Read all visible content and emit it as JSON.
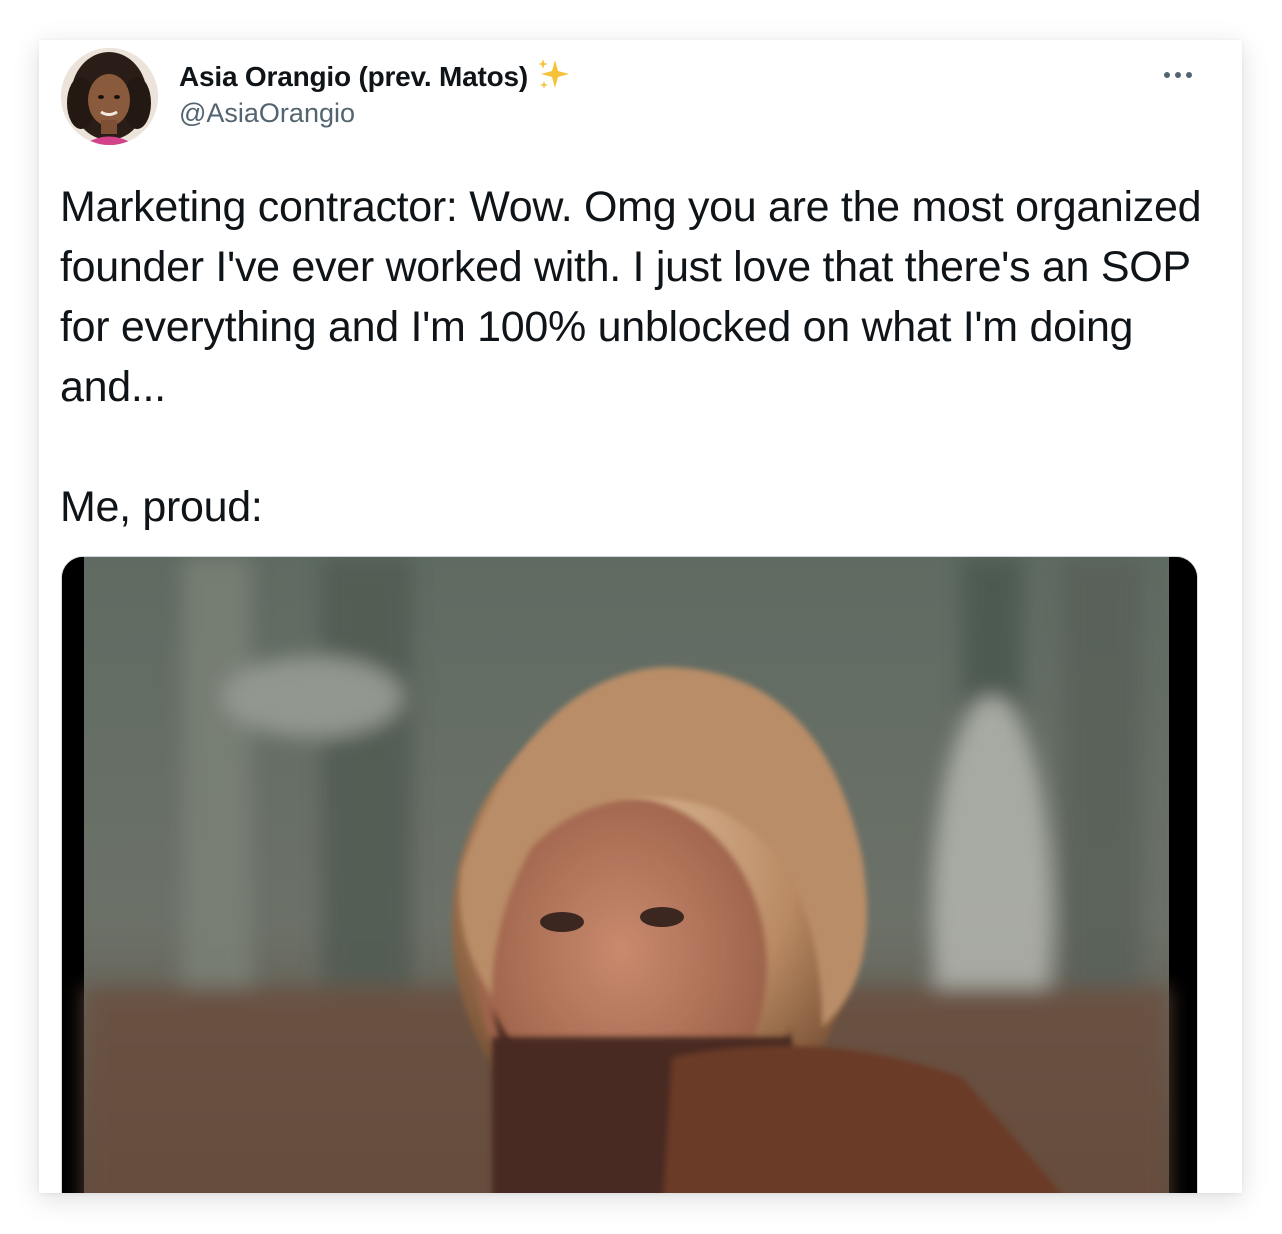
{
  "tweet": {
    "author": {
      "display_name": "Asia Orangio (prev. Matos)",
      "handle": "@AsiaOrangio",
      "badge_icon": "sparkles-icon",
      "avatar_icon": "profile-photo"
    },
    "more_icon": "more-horizontal-icon",
    "text": "Marketing contractor: Wow. Omg you are the most organized founder I've ever worked with. I just love that there's an SOP for everything and I'm 100% unblocked on what I'm doing and...\n\nMe, proud:",
    "media": {
      "kind": "video-still",
      "description_icon": "bearded-man-photo"
    }
  },
  "colors": {
    "text_primary": "#0f1419",
    "text_secondary": "#536471",
    "sparkle": "#f5c23a",
    "card_background": "#ffffff"
  }
}
